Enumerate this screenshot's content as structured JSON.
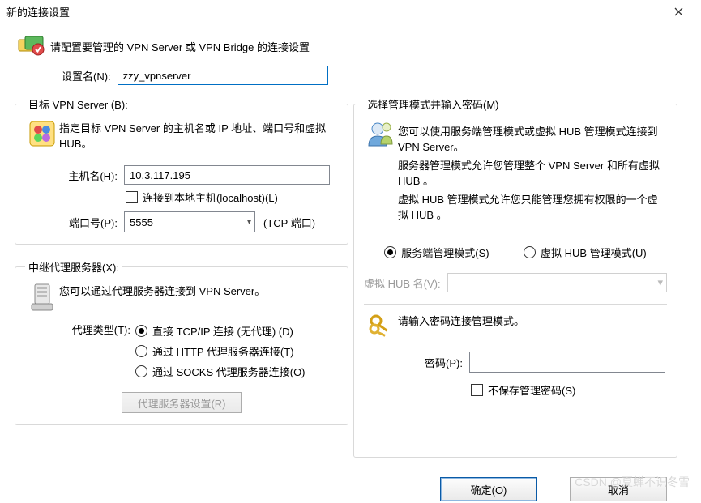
{
  "window": {
    "title": "新的连接设置"
  },
  "intro": {
    "text": "请配置要管理的 VPN Server 或 VPN Bridge 的连接设置"
  },
  "name": {
    "label": "设置名(N):",
    "value": "zzy_vpnserver"
  },
  "target": {
    "legend": "目标 VPN Server (B):",
    "desc": "指定目标 VPN Server 的主机名或 IP 地址、端口号和虚拟 HUB。",
    "host_label": "主机名(H):",
    "host_value": "10.3.117.195",
    "localhost_label": "连接到本地主机(localhost)(L)",
    "port_label": "端口号(P):",
    "port_value": "5555",
    "port_suffix": "(TCP 端口)"
  },
  "proxy": {
    "legend": "中继代理服务器(X):",
    "desc": "您可以通过代理服务器连接到 VPN Server。",
    "type_label": "代理类型(T):",
    "opt_direct": "直接 TCP/IP 连接 (无代理) (D)",
    "opt_http": "通过 HTTP 代理服务器连接(T)",
    "opt_socks": "通过 SOCKS 代理服务器连接(O)",
    "settings_button": "代理服务器设置(R)"
  },
  "mode": {
    "legend": "选择管理模式并输入密码(M)",
    "desc1": "您可以使用服务端管理模式或虚拟 HUB 管理模式连接到 VPN Server。",
    "desc2": "服务器管理模式允许您管理整个 VPN Server 和所有虚拟 HUB 。",
    "desc3": "虚拟 HUB 管理模式允许您只能管理您拥有权限的一个虚拟 HUB 。",
    "server_mode": "服务端管理模式(S)",
    "hub_mode": "虚拟 HUB 管理模式(U)",
    "hub_name_label": "虚拟 HUB 名(V):",
    "pw_prompt": "请输入密码连接管理模式。",
    "pw_label": "密码(P):",
    "no_save_pw": "不保存管理密码(S)"
  },
  "footer": {
    "ok": "确定(O)",
    "cancel": "取消"
  },
  "watermark": "CSDN @夏蝉不识冬雪"
}
